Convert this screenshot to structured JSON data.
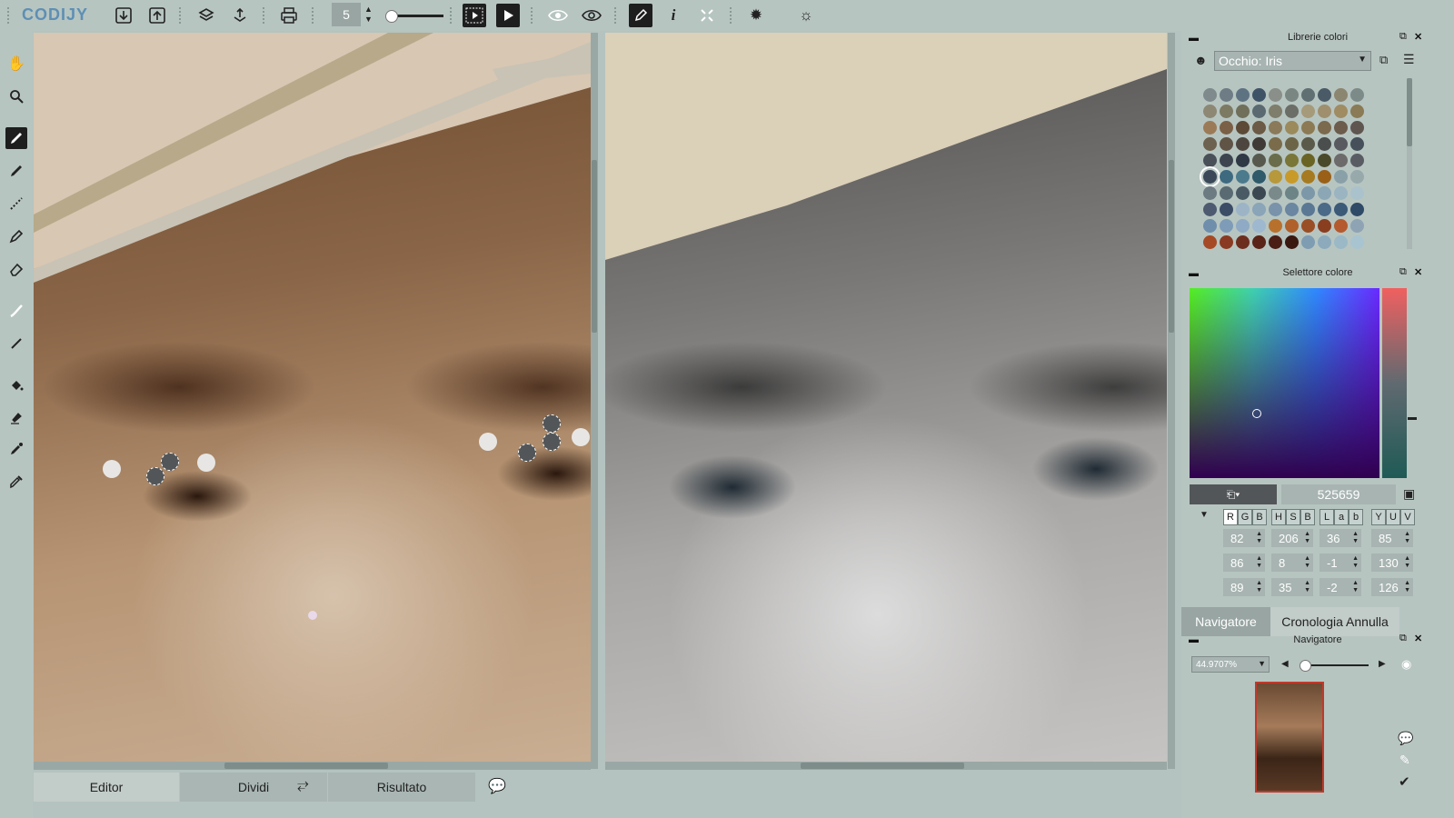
{
  "app": {
    "logo": "CODIJY"
  },
  "toolbar": {
    "brush_size": "5",
    "icons": [
      "grip-icon",
      "download-icon",
      "upload-icon",
      "print-icon",
      "brush-size-stepper",
      "film-play-icon",
      "play-icon",
      "eye-icon",
      "eye-compare-icon",
      "pen-tool-icon",
      "info-icon",
      "fit-icon",
      "settings-gear-icon",
      "bug-settings-icon"
    ]
  },
  "left_tools": [
    "hand-icon",
    "zoom-icon",
    "brush-icon",
    "marker-icon",
    "stitch-icon",
    "pencil-icon",
    "eraser-icon",
    "smudge-icon",
    "line-icon",
    "fill-bucket-icon",
    "stamp-icon",
    "color-picker-icon",
    "eyedropper-icon"
  ],
  "bottom_tabs": {
    "editor": "Editor",
    "split": "Dividi",
    "result": "Risultato"
  },
  "color_library": {
    "title": "Librerie colori",
    "library": "Occhio: Iris",
    "swatches": [
      [
        "#7e8a8b",
        "#6d7c85",
        "#5e7382",
        "#3e5466",
        "#8a8f8a",
        "#7a8682",
        "#5f6f72",
        "#4a5a66",
        "#8b8670",
        "#7d8b88"
      ],
      [
        "#8d8874",
        "#7c7a63",
        "#6f6f5a",
        "#5a6a70",
        "#7f7d6b",
        "#6b6e66",
        "#a59a7a",
        "#9f8f6f",
        "#a08c62",
        "#8a7a55"
      ],
      [
        "#9b7b57",
        "#7a6046",
        "#5c4a36",
        "#6b5a45",
        "#8a7a5a",
        "#9b8a5c",
        "#8c7a55",
        "#7b6a4d",
        "#6c5c4c",
        "#5f5650"
      ],
      [
        "#6d614f",
        "#5f5445",
        "#4d463e",
        "#3f3a36",
        "#7a6c4a",
        "#6c6446",
        "#5a5a4a",
        "#4a4e4c",
        "#585a60",
        "#45505a"
      ],
      [
        "#4a5058",
        "#3d4450",
        "#2f3845",
        "#57594f",
        "#6a6d4a",
        "#7a7638",
        "#6a6424",
        "#4a4a2a",
        "#6c6a6a",
        "#5a5c64"
      ],
      [
        "#3a4858",
        "#3e6a80",
        "#4a7a8c",
        "#2f5a6a",
        "#b7983a",
        "#c89a2a",
        "#a67a20",
        "#9a6018",
        "#8aa0a8",
        "#98a9ac"
      ],
      [
        "#6c7a82",
        "#5a6a72",
        "#4a5a64",
        "#3b4852",
        "#7a8a8a",
        "#6c8486",
        "#7b97a8",
        "#8ba6b4",
        "#9bb4c2",
        "#aac2cc"
      ],
      [
        "#4d5a70",
        "#3a4c66",
        "#9cb4c6",
        "#8aa4b8",
        "#7893aa",
        "#6a86a0",
        "#5a7894",
        "#4a6a88",
        "#3a5a78",
        "#2f4a66"
      ],
      [
        "#6e8eac",
        "#7e9cb8",
        "#8eaac4",
        "#9eb8cf",
        "#b8712c",
        "#b0602a",
        "#9a4e24",
        "#8a3e20",
        "#b45a2e",
        "#8ea4b4"
      ],
      [
        "#a64a26",
        "#8a3a22",
        "#6e2e1e",
        "#5a2418",
        "#4a1e14",
        "#3a1810",
        "#7e9cb2",
        "#8caabc",
        "#9ab8c6",
        "#a8c4d0"
      ]
    ]
  },
  "color_picker": {
    "title": "Selettore colore",
    "hex": "525659",
    "modes": {
      "rgb": [
        "R",
        "G",
        "B"
      ],
      "hsb": [
        "H",
        "S",
        "B"
      ],
      "lab": [
        "L",
        "a",
        "b"
      ],
      "yuv": [
        "Y",
        "U",
        "V"
      ]
    },
    "values": {
      "r": "82",
      "g": "86",
      "b": "89",
      "h": "206",
      "s": "8",
      "bri": "35",
      "l": "36",
      "a": "-1",
      "lb": "-2",
      "y": "85",
      "u": "130",
      "v": "126"
    }
  },
  "navigator": {
    "tabs": {
      "navigator": "Navigatore",
      "history": "Cronologia Annulla"
    },
    "title": "Navigatore",
    "zoom": "44.9707%"
  },
  "colors": {
    "accent": "#1e1e1e",
    "panel": "#b7c5c1"
  }
}
